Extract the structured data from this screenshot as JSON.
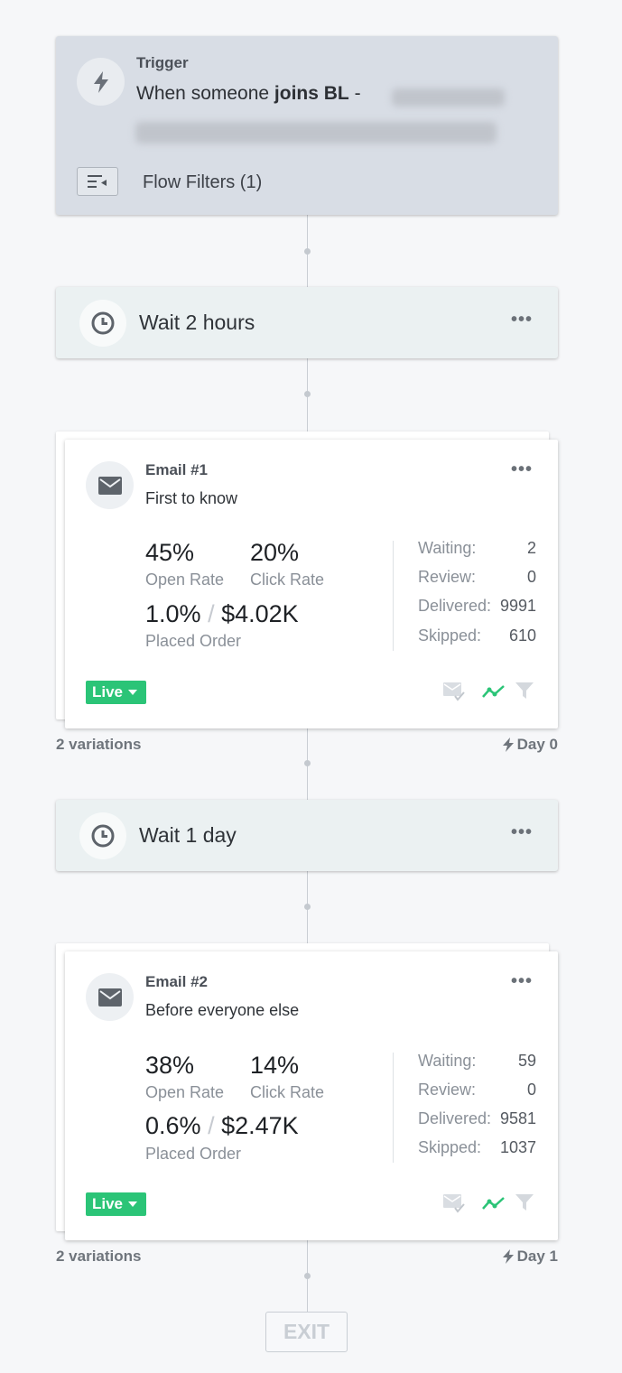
{
  "trigger": {
    "label": "Trigger",
    "text_prefix": "When someone ",
    "text_bold": "joins BL",
    "text_suffix": " -",
    "filters_label": "Flow Filters (1)"
  },
  "waits": [
    {
      "label": "Wait 2 hours",
      "menu": "•••"
    },
    {
      "label": "Wait 1 day",
      "menu": "•••"
    }
  ],
  "emails": [
    {
      "title": "Email #1",
      "subject": "First to know",
      "menu": "•••",
      "open_rate": "45%",
      "open_rate_label": "Open Rate",
      "click_rate": "20%",
      "click_rate_label": "Click Rate",
      "placed_pct": "1.0%",
      "slash": "/",
      "placed_value": "$4.02K",
      "placed_label": "Placed Order",
      "stats": [
        {
          "key": "Waiting:",
          "value": "2"
        },
        {
          "key": "Review:",
          "value": "0"
        },
        {
          "key": "Delivered:",
          "value": "9991"
        },
        {
          "key": "Skipped:",
          "value": "610"
        }
      ],
      "status": "Live",
      "variations": "2 variations",
      "day": "Day 0"
    },
    {
      "title": "Email #2",
      "subject": "Before everyone else",
      "menu": "•••",
      "open_rate": "38%",
      "open_rate_label": "Open Rate",
      "click_rate": "14%",
      "click_rate_label": "Click Rate",
      "placed_pct": "0.6%",
      "slash": "/",
      "placed_value": "$2.47K",
      "placed_label": "Placed Order",
      "stats": [
        {
          "key": "Waiting:",
          "value": "59"
        },
        {
          "key": "Review:",
          "value": "0"
        },
        {
          "key": "Delivered:",
          "value": "9581"
        },
        {
          "key": "Skipped:",
          "value": "1037"
        }
      ],
      "status": "Live",
      "variations": "2 variations",
      "day": "Day 1"
    }
  ],
  "exit_label": "EXIT",
  "colors": {
    "live_green": "#2bc477",
    "trigger_bg": "#d8dde5",
    "wait_bg": "#ebf1f2"
  }
}
